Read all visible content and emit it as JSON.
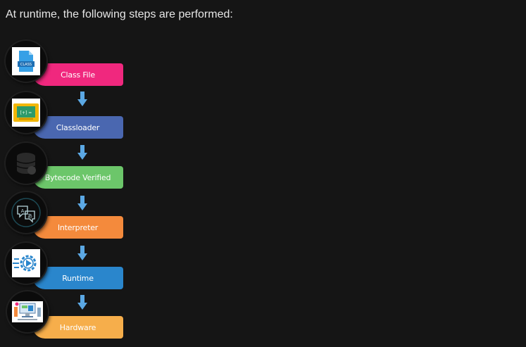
{
  "intro_text": "At runtime, the following steps are performed:",
  "steps": [
    {
      "label": "Class File",
      "color": "#f0287e",
      "icon": "class-file-icon"
    },
    {
      "label": "Classloader",
      "color": "#4a67b0",
      "icon": "classloader-icon"
    },
    {
      "label": "Bytecode Verified",
      "color": "#6cc66a",
      "icon": "database-icon"
    },
    {
      "label": "Interpreter",
      "color": "#f48a3c",
      "icon": "translate-icon"
    },
    {
      "label": "Runtime",
      "color": "#2a86cc",
      "icon": "gear-play-icon"
    },
    {
      "label": "Hardware",
      "color": "#f6ae4b",
      "icon": "computer-icon"
    }
  ],
  "arrow_color": "#5ba8e4"
}
